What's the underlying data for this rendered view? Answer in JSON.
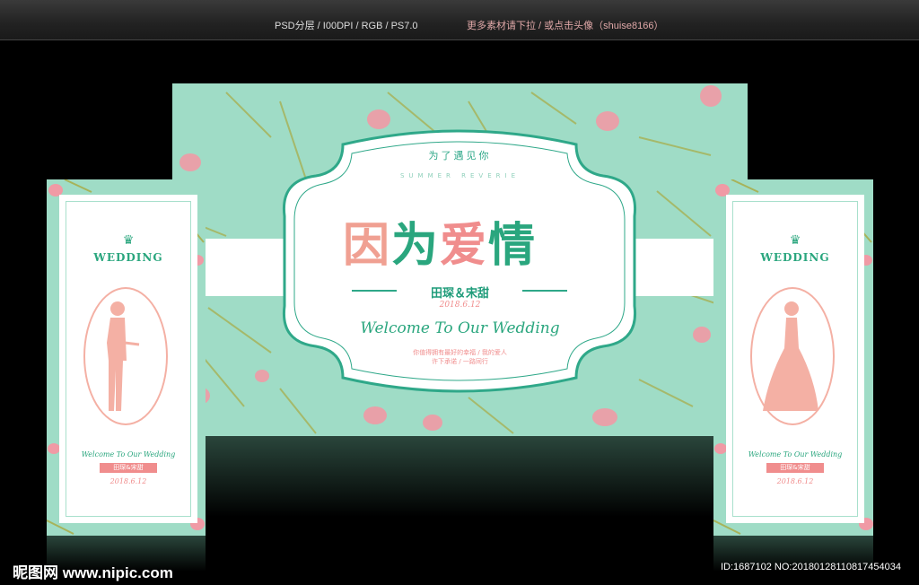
{
  "topbar": {
    "specs": "PSD分层 /  I00DPI / RGB / PS7.0",
    "note": "更多素材请下拉 / 或点击头像（shuise8166）"
  },
  "main": {
    "subtitle": "为了遇见你",
    "english_sub": "SUMMER REVERIE",
    "title_chars": [
      "因",
      "为",
      "爱",
      "情"
    ],
    "names": "田琛＆宋甜",
    "date": "2018.6.12",
    "welcome": "Welcome To Our Wedding",
    "verse_line1": "你值得拥有最好的幸福 / 我的爱人",
    "verse_line2": "许下承诺 / 一路同行"
  },
  "side_left": {
    "badge": "WEDDING",
    "welcome": "Welcome To Our Wedding",
    "names": "田琛&宋甜",
    "date": "2018.6.12",
    "figure": "groom-silhouette"
  },
  "side_right": {
    "badge": "WEDDING",
    "welcome": "Welcome To Our Wedding",
    "names": "田琛&宋甜",
    "date": "2018.6.12",
    "figure": "bride-silhouette"
  },
  "watermark": {
    "brand": "昵图网 www.nipic.com",
    "id_text": "ID:1687102 NO:20180128110817454034"
  },
  "colors": {
    "mint": "#9fdcc6",
    "green": "#2aa67e",
    "pink": "#f08d8d",
    "peach": "#f0a092"
  }
}
